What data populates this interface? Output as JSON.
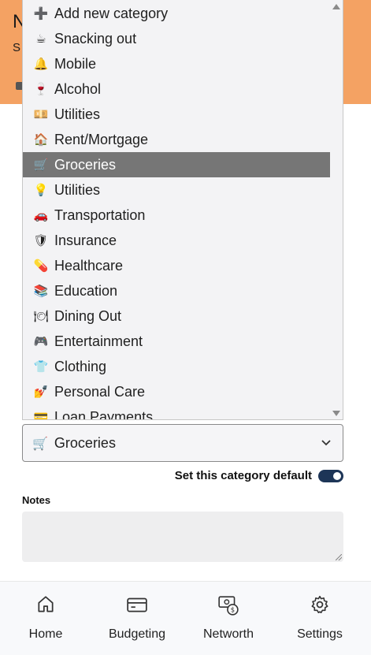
{
  "header": {
    "title_fragment": "N",
    "subtitle_fragment": "S"
  },
  "dropdown": {
    "options": [
      {
        "icon": "plus-icon",
        "glyph": "➕",
        "label": "Add new category",
        "selected": false
      },
      {
        "icon": "coffee-icon",
        "glyph": "☕",
        "label": "Snacking out",
        "selected": false
      },
      {
        "icon": "bell-icon",
        "glyph": "🔔",
        "label": "Mobile",
        "selected": false
      },
      {
        "icon": "wine-glass-icon",
        "glyph": "🍷",
        "label": "Alcohol",
        "selected": false
      },
      {
        "icon": "money-icon",
        "glyph": "💴",
        "label": "Utilities",
        "selected": false
      },
      {
        "icon": "house-icon",
        "glyph": "🏠",
        "label": "Rent/Mortgage",
        "selected": false
      },
      {
        "icon": "cart-icon",
        "glyph": "🛒",
        "label": "Groceries",
        "selected": true
      },
      {
        "icon": "lightbulb-icon",
        "glyph": "💡",
        "label": "Utilities",
        "selected": false
      },
      {
        "icon": "car-icon",
        "glyph": "🚗",
        "label": "Transportation",
        "selected": false
      },
      {
        "icon": "shield-icon",
        "glyph": "🛡",
        "label": "Insurance",
        "selected": false
      },
      {
        "icon": "medical-icon",
        "glyph": "💊",
        "label": "Healthcare",
        "selected": false
      },
      {
        "icon": "books-icon",
        "glyph": "📚",
        "label": "Education",
        "selected": false
      },
      {
        "icon": "plate-icon",
        "glyph": "🍽",
        "label": "Dining Out",
        "selected": false
      },
      {
        "icon": "gamepad-icon",
        "glyph": "🎮",
        "label": "Entertainment",
        "selected": false
      },
      {
        "icon": "shirt-icon",
        "glyph": "👕",
        "label": "Clothing",
        "selected": false
      },
      {
        "icon": "nail-polish-icon",
        "glyph": "💅",
        "label": "Personal Care",
        "selected": false
      },
      {
        "icon": "credit-card-icon",
        "glyph": "💳",
        "label": "Loan Payments",
        "selected": false
      }
    ]
  },
  "category_select": {
    "icon": "cart-icon",
    "glyph": "🛒",
    "value": "Groceries"
  },
  "default_toggle": {
    "label": "Set this category default",
    "on": true,
    "color": "#1d3557"
  },
  "notes": {
    "label": "Notes",
    "value": ""
  },
  "nav": {
    "items": [
      {
        "icon": "home-icon",
        "label": "Home"
      },
      {
        "icon": "card-icon",
        "label": "Budgeting"
      },
      {
        "icon": "money-bill-icon",
        "label": "Networth"
      },
      {
        "icon": "gear-icon",
        "label": "Settings"
      }
    ]
  },
  "colors": {
    "header": "#f4a263",
    "selected_row": "#767676"
  }
}
